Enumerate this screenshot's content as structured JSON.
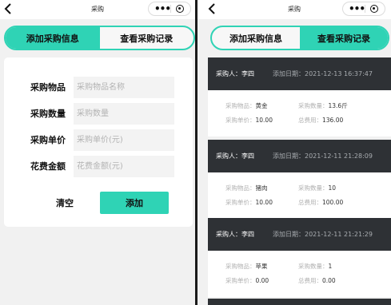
{
  "nav": {
    "title": "采购",
    "more_label": "•••"
  },
  "tabs": [
    {
      "label": "添加采购信息"
    },
    {
      "label": "查看采购记录"
    }
  ],
  "form": {
    "fields": [
      {
        "label": "采购物品",
        "placeholder": "采购物品名称"
      },
      {
        "label": "采购数量",
        "placeholder": "采购数量"
      },
      {
        "label": "采购单价",
        "placeholder": "采购单价(元)"
      },
      {
        "label": "花费金额",
        "placeholder": "花费金额(元)"
      }
    ],
    "clear_label": "清空",
    "add_label": "添加"
  },
  "records": [
    {
      "buyer": "采购人：李四",
      "date": "添加日期：2021-12-13 16:37:47",
      "item_label": "采购物品：",
      "item": "黄金",
      "qty_label": "采购数量：",
      "qty": "13.6斤",
      "price_label": "采购单价：",
      "price": "10.00",
      "total_label": "总费用：",
      "total": "136.00"
    },
    {
      "buyer": "采购人：李四",
      "date": "添加日期：2021-12-11 21:28:09",
      "item_label": "采购物品：",
      "item": "猪肉",
      "qty_label": "采购数量：",
      "qty": "10",
      "price_label": "采购单价：",
      "price": "10.00",
      "total_label": "总费用：",
      "total": "100.00"
    },
    {
      "buyer": "采购人：李四",
      "date": "添加日期：2021-12-11 21:21:29",
      "item_label": "采购物品：",
      "item": "苹果",
      "qty_label": "采购数量：",
      "qty": "1",
      "price_label": "采购单价：",
      "price": "0.00",
      "total_label": "总费用：",
      "total": "0.00"
    }
  ],
  "colors": {
    "accent": "#2fd3b5",
    "record_header": "#2e3135",
    "page_bg": "#f1f1f1"
  }
}
